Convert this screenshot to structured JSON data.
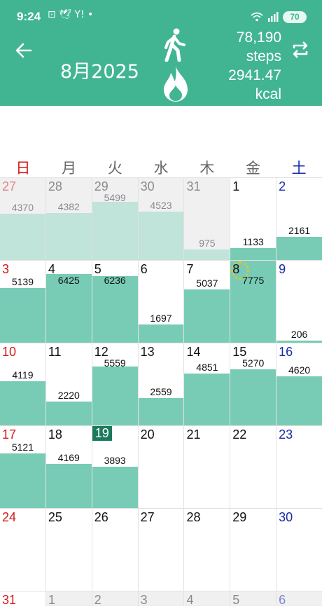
{
  "status_bar": {
    "time": "9:24",
    "icons": "⊡ 🕊 Y! •",
    "battery": "70"
  },
  "header": {
    "month_title": "8月2025",
    "steps_value": "78,190",
    "steps_unit": "steps",
    "kcal_value": "2941.47",
    "kcal_unit": "kcal",
    "icons": {
      "back": "arrow-left-icon",
      "walk": "walking-person-icon",
      "fire": "flame-icon",
      "refresh": "repeat-icon"
    }
  },
  "colors": {
    "header": "#41b591",
    "bar": "#78ccb6",
    "bar_other_month": "#c0e3da",
    "sunday": "#d21a1a",
    "saturday": "#1a2ba8",
    "today": "#1c7a5c"
  },
  "weekdays": [
    "日",
    "月",
    "火",
    "水",
    "木",
    "金",
    "土"
  ],
  "bar_scale_max_steps": 7775,
  "weeks": [
    [
      {
        "day": "27",
        "steps": "4370",
        "other": true
      },
      {
        "day": "28",
        "steps": "4382",
        "other": true
      },
      {
        "day": "29",
        "steps": "5499",
        "other": true
      },
      {
        "day": "30",
        "steps": "4523",
        "other": true
      },
      {
        "day": "31",
        "steps": "975",
        "other": true
      },
      {
        "day": "1",
        "steps": "1133"
      },
      {
        "day": "2",
        "steps": "2161"
      }
    ],
    [
      {
        "day": "3",
        "steps": "5139"
      },
      {
        "day": "4",
        "steps": "6425"
      },
      {
        "day": "5",
        "steps": "6236"
      },
      {
        "day": "6",
        "steps": "1697"
      },
      {
        "day": "7",
        "steps": "5037"
      },
      {
        "day": "8",
        "steps": "7775",
        "medal": true
      },
      {
        "day": "9",
        "steps": "206"
      }
    ],
    [
      {
        "day": "10",
        "steps": "4119"
      },
      {
        "day": "11",
        "steps": "2220"
      },
      {
        "day": "12",
        "steps": "5559"
      },
      {
        "day": "13",
        "steps": "2559"
      },
      {
        "day": "14",
        "steps": "4851"
      },
      {
        "day": "15",
        "steps": "5270"
      },
      {
        "day": "16",
        "steps": "4620"
      }
    ],
    [
      {
        "day": "17",
        "steps": "5121"
      },
      {
        "day": "18",
        "steps": "4169"
      },
      {
        "day": "19",
        "steps": "3893",
        "today": true
      },
      {
        "day": "20",
        "steps": ""
      },
      {
        "day": "21",
        "steps": ""
      },
      {
        "day": "22",
        "steps": ""
      },
      {
        "day": "23",
        "steps": ""
      }
    ],
    [
      {
        "day": "24",
        "steps": ""
      },
      {
        "day": "25",
        "steps": ""
      },
      {
        "day": "26",
        "steps": ""
      },
      {
        "day": "27",
        "steps": ""
      },
      {
        "day": "28",
        "steps": ""
      },
      {
        "day": "29",
        "steps": ""
      },
      {
        "day": "30",
        "steps": ""
      }
    ],
    [
      {
        "day": "31",
        "steps": ""
      },
      {
        "day": "1",
        "steps": "",
        "other": true
      },
      {
        "day": "2",
        "steps": "",
        "other": true
      },
      {
        "day": "3",
        "steps": "",
        "other": true
      },
      {
        "day": "4",
        "steps": "",
        "other": true
      },
      {
        "day": "5",
        "steps": "",
        "other": true
      },
      {
        "day": "6",
        "steps": "",
        "other": true
      }
    ]
  ]
}
